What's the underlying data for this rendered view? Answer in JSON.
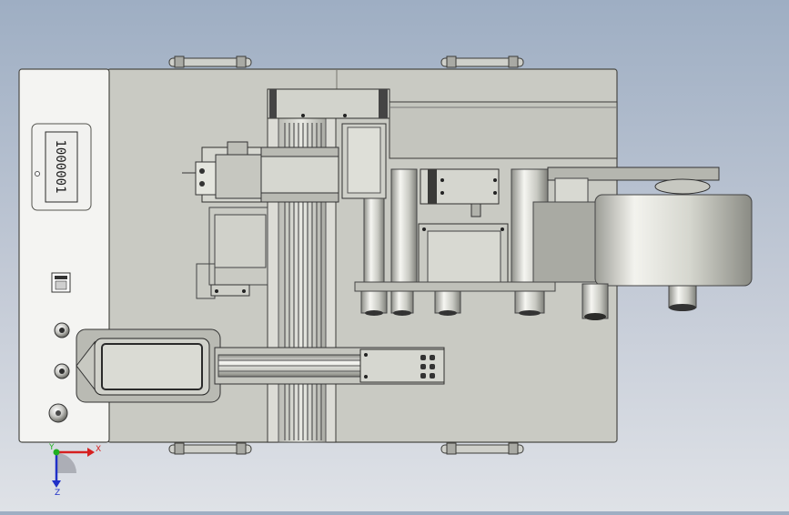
{
  "view": {
    "background_top": "#9eaec3",
    "background_bottom": "#dfe2e7"
  },
  "machine": {
    "panel_color": "#c9cac3",
    "control_panel_color": "#f4f4f2",
    "display_text": "1000001",
    "display_icon": "screen-icon",
    "handles": 4,
    "buttons": [
      "knob-button",
      "knob-button",
      "emergency-stop-button"
    ]
  },
  "triad": {
    "x_label": "X",
    "y_label": "Y",
    "z_label": "Z",
    "x_color": "#d62020",
    "y_color": "#20b020",
    "z_color": "#2030c8"
  }
}
